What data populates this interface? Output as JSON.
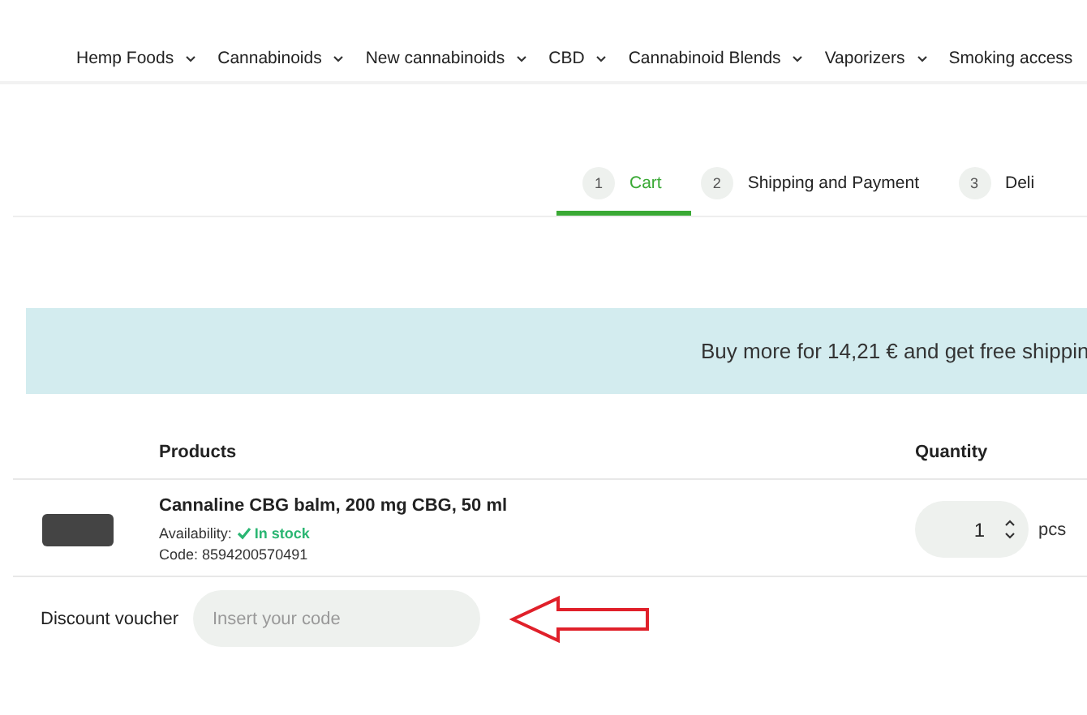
{
  "nav": {
    "items": [
      {
        "label": "Hemp Foods"
      },
      {
        "label": "Cannabinoids"
      },
      {
        "label": "New cannabinoids"
      },
      {
        "label": "CBD"
      },
      {
        "label": "Cannabinoid Blends"
      },
      {
        "label": "Vaporizers"
      },
      {
        "label": "Smoking access"
      }
    ]
  },
  "steps": [
    {
      "number": "1",
      "label": "Cart",
      "selected": true
    },
    {
      "number": "2",
      "label": "Shipping and Payment",
      "selected": false
    },
    {
      "number": "3",
      "label": "Deli",
      "selected": false
    }
  ],
  "banner": {
    "text": "Buy more for 14,21 € and get free shippin"
  },
  "table": {
    "columns": [
      "Products",
      "Quantity"
    ],
    "rows": [
      {
        "name": "Cannaline CBG balm, 200 mg CBG, 50 ml",
        "availability_label": "Availability:",
        "availability": "In stock",
        "in_stock": true,
        "code": "Code: 8594200570491",
        "quantity": "1",
        "unit": "pcs"
      }
    ]
  },
  "voucher": {
    "label": "Discount voucher",
    "placeholder": "Insert your code"
  }
}
